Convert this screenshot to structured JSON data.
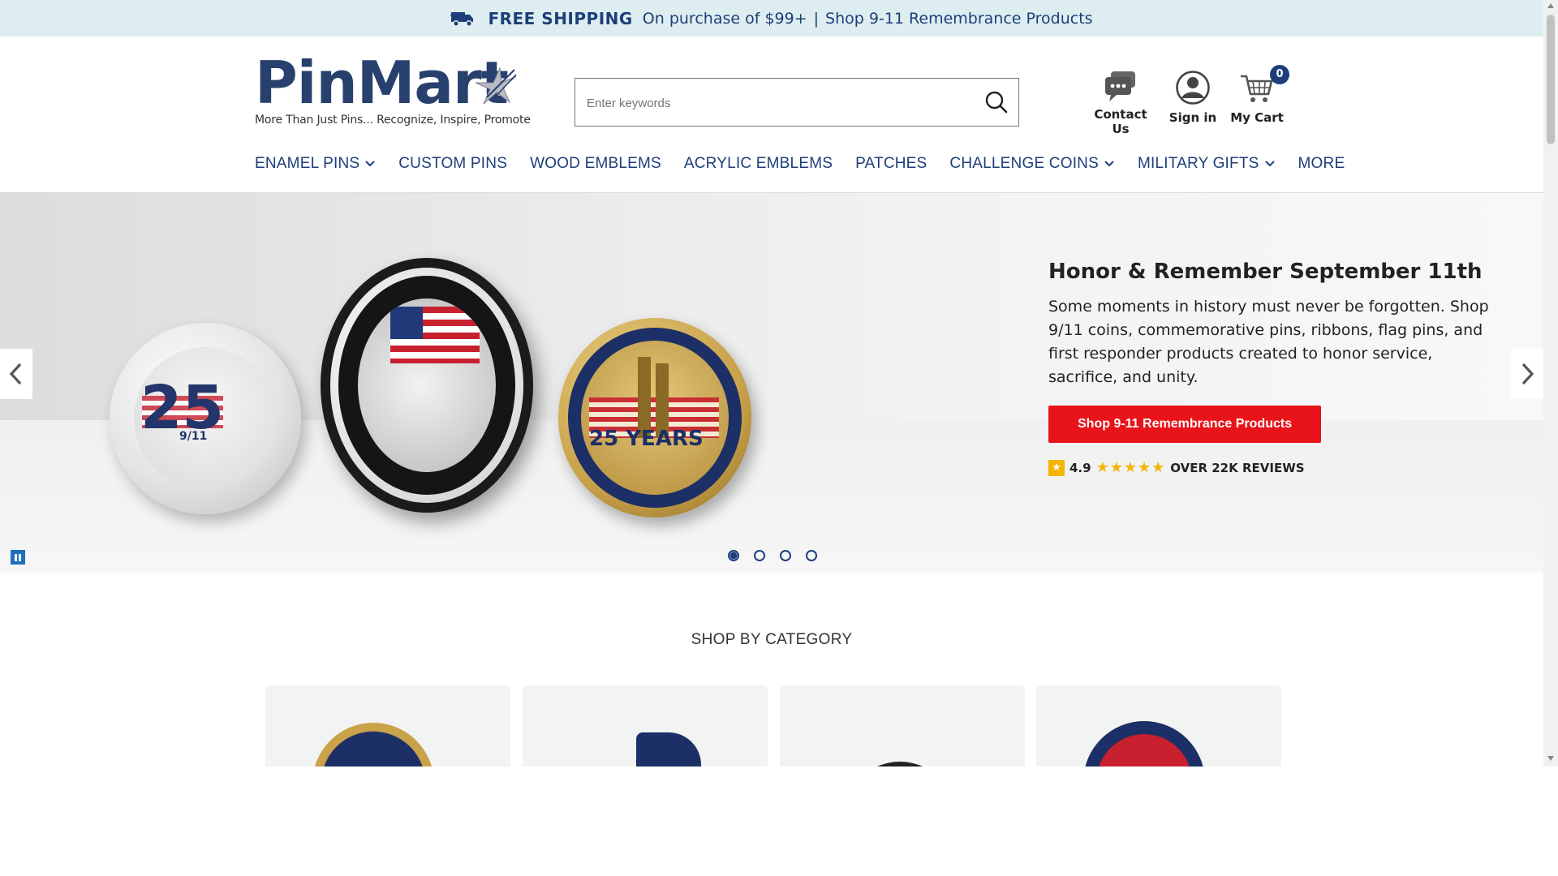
{
  "promo": {
    "icon": "truck-icon",
    "free_shipping": "FREE SHIPPING",
    "text": "On purchase of $99+",
    "separator": "|",
    "link": "Shop 9-11 Remembrance Products"
  },
  "logo": {
    "name": "PinMart",
    "tagline": "More Than Just Pins... Recognize, Inspire, Promote"
  },
  "search": {
    "placeholder": "Enter keywords",
    "icon": "search-icon"
  },
  "header_actions": {
    "contact": "Contact Us",
    "signin": "Sign in",
    "cart": "My Cart",
    "cart_count": "0"
  },
  "nav": {
    "items": [
      {
        "label": "ENAMEL PINS",
        "dropdown": true
      },
      {
        "label": "CUSTOM PINS",
        "dropdown": false
      },
      {
        "label": "WOOD EMBLEMS",
        "dropdown": false
      },
      {
        "label": "ACRYLIC EMBLEMS",
        "dropdown": false
      },
      {
        "label": "PATCHES",
        "dropdown": false
      },
      {
        "label": "CHALLENGE COINS",
        "dropdown": true
      },
      {
        "label": "MILITARY GIFTS",
        "dropdown": true
      },
      {
        "label": "MORE",
        "dropdown": false
      }
    ]
  },
  "hero": {
    "title": "Honor & Remember September 11th",
    "description": "Some moments in history must never be forgotten. Shop 9/11 coins, commemorative pins, ribbons, flag pins, and first responder products created to honor service, sacrifice, and unity.",
    "button": "Shop 9-11 Remembrance Products",
    "rating_value": "4.9",
    "stars": "★★★★★",
    "reviews": "OVER 22K REVIEWS",
    "coin1_number": "25",
    "coin1_date": "9/11",
    "coin3_text": "25 YEARS",
    "slides_total": 4,
    "active_slide": 1
  },
  "categories": {
    "title": "SHOP BY CATEGORY"
  },
  "colors": {
    "brand_navy": "#1d3e7a",
    "cta_red": "#e8141a",
    "promo_bg": "#deeef0",
    "star_gold": "#f4b400"
  }
}
